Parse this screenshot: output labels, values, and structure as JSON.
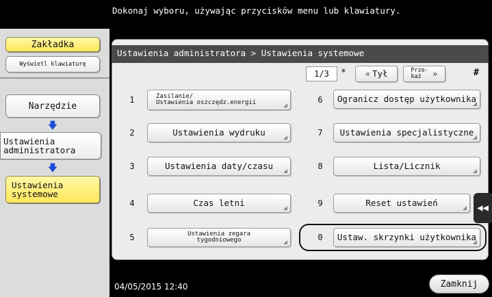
{
  "top_message": "Dokonaj wyboru, używając przycisków menu lub klawiatury.",
  "left": {
    "tab_button": "Zakładka",
    "keyboard_button": "Wyświetl klawiaturę",
    "tools_button": "Narzędzie",
    "admin_settings": "Ustawienia administratora",
    "system_settings": "Ustawienia systemowe"
  },
  "breadcrumb": "Ustawienia administratora > Ustawienia systemowe",
  "pager": {
    "page": "1/3",
    "star": "*",
    "back_label": "Tył",
    "next_label": "Prze-\nkaż",
    "hash": "#"
  },
  "menu": [
    {
      "num": "1",
      "label": "Zasilanie/\nUstawienia oszczędz.energii"
    },
    {
      "num": "2",
      "label": "Ustawienia wydruku"
    },
    {
      "num": "3",
      "label": "Ustawienia daty/czasu"
    },
    {
      "num": "4",
      "label": "Czas letni"
    },
    {
      "num": "5",
      "label": "Ustawienia zegara\ntygodniowego"
    },
    {
      "num": "6",
      "label": "Ogranicz dostęp użytkownika"
    },
    {
      "num": "7",
      "label": "Ustawienia specjalistyczne"
    },
    {
      "num": "8",
      "label": "Lista/Licznik"
    },
    {
      "num": "9",
      "label": "Reset ustawień"
    },
    {
      "num": "0",
      "label": "Ustaw. skrzynki użytkownika"
    }
  ],
  "datetime": "04/05/2015  12:40",
  "close_button": "Zamknij",
  "colors": {
    "accent_yellow": "#ffe85a",
    "breadcrumb_bg": "#4a4a4a",
    "arrow_blue": "#1a4bd8"
  }
}
